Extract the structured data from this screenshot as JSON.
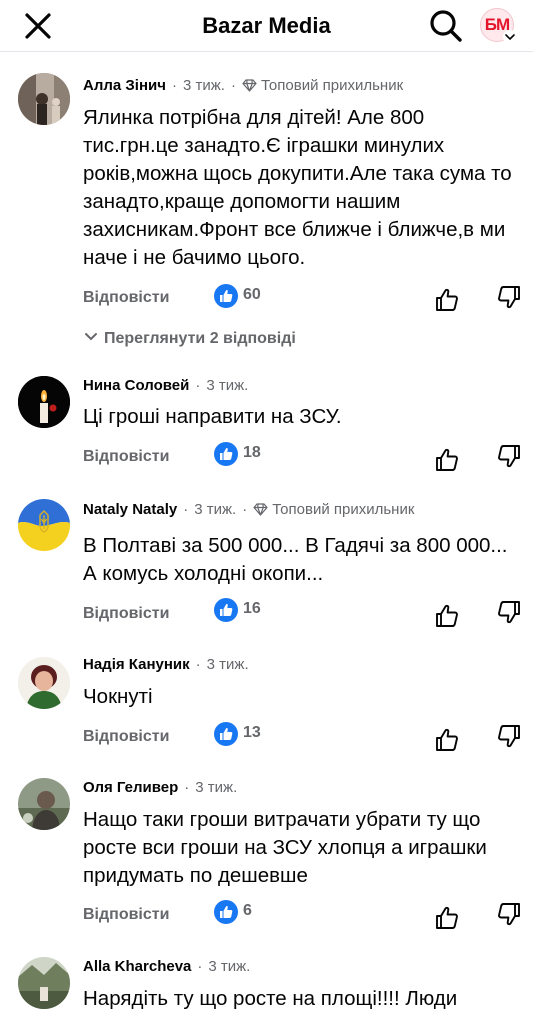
{
  "header": {
    "title": "Bazar Media",
    "page_avatar_text": "БМ"
  },
  "icons": {
    "close": "close-icon",
    "search": "search-icon",
    "like": "like-icon",
    "thumb_up": "thumb-up-icon",
    "thumb_down": "thumb-down-icon",
    "badge": "diamond-badge-icon",
    "chevron": "chevron-down-icon"
  },
  "colors": {
    "like_blue": "#1877f2",
    "meta_gray": "#65676b",
    "text": "#050505",
    "brand_red": "#e3162b"
  },
  "comments": [
    {
      "author": "Алла Зінич",
      "time": "3 тиж.",
      "badge": "Топовий прихильник",
      "text": "Ялинка потрібна для дітей! Але 800 тис.грн.це занадто.Є іграшки минулих років,можна щось докупити.Але така сума то занадто,краще допомогти нашим захисникам.Фронт все ближче і ближче,в ми наче і не бачимо цього.",
      "reply_label": "Відповісти",
      "likes": "60",
      "view_replies": "Переглянути 2 відповіді"
    },
    {
      "author": "Нина Соловей",
      "time": "3 тиж.",
      "text": "Ці гроші направити на ЗСУ.",
      "reply_label": "Відповісти",
      "likes": "18"
    },
    {
      "author": "Nataly Nataly",
      "time": "3 тиж.",
      "badge": "Топовий прихильник",
      "text": "В Полтаві за 500 000... В Гадячі за 800 000... А комусь холодні окопи...",
      "reply_label": "Відповісти",
      "likes": "16"
    },
    {
      "author": "Надія Кануник",
      "time": "3 тиж.",
      "text": "Чокнуті",
      "reply_label": "Відповісти",
      "likes": "13"
    },
    {
      "author": "Оля Геливер",
      "time": "3 тиж.",
      "text": "Нащо таки гроши витрачати убрати ту що росте вси гроши на ЗСУ хлопця а играшки придумать по дешевше",
      "reply_label": "Відповісти",
      "likes": "6"
    },
    {
      "author": "Alla Kharcheva",
      "time": "3 тиж.",
      "text": "Нарядіть ту що росте на площі!!!! Люди"
    }
  ]
}
